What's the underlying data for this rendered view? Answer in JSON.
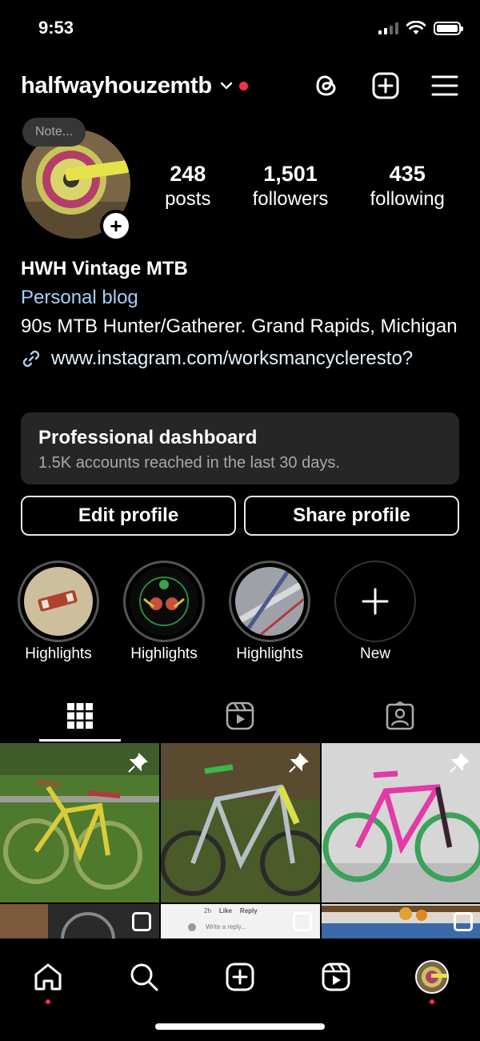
{
  "status_bar": {
    "time": "9:53"
  },
  "header": {
    "username": "halfwayhouzemtb",
    "icons": [
      "threads-icon",
      "create-icon",
      "menu-icon"
    ]
  },
  "profile": {
    "note_label": "Note...",
    "stats": [
      {
        "value": "248",
        "label": "posts"
      },
      {
        "value": "1,501",
        "label": "followers"
      },
      {
        "value": "435",
        "label": "following"
      }
    ]
  },
  "bio": {
    "name": "HWH Vintage MTB",
    "category": "Personal blog",
    "text": "90s MTB Hunter/Gatherer. Grand Rapids, Michigan",
    "link": "www.instagram.com/worksmancycleresto?"
  },
  "dashboard": {
    "title": "Professional dashboard",
    "subtitle": "1.5K accounts reached in the last 30 days."
  },
  "buttons": {
    "edit": "Edit profile",
    "share": "Share profile"
  },
  "highlights": [
    {
      "label": "Highlights"
    },
    {
      "label": "Highlights"
    },
    {
      "label": "Highlights"
    },
    {
      "label": "New"
    }
  ],
  "grid_partial": {
    "reply_meta_time": "2h",
    "reply_meta_like": "Like",
    "reply_meta_reply": "Reply",
    "reply_placeholder": "Write a reply..."
  },
  "colors": {
    "accent_blue": "#a8d0f5",
    "notification_red": "#ff3040",
    "card_bg": "#262626"
  }
}
